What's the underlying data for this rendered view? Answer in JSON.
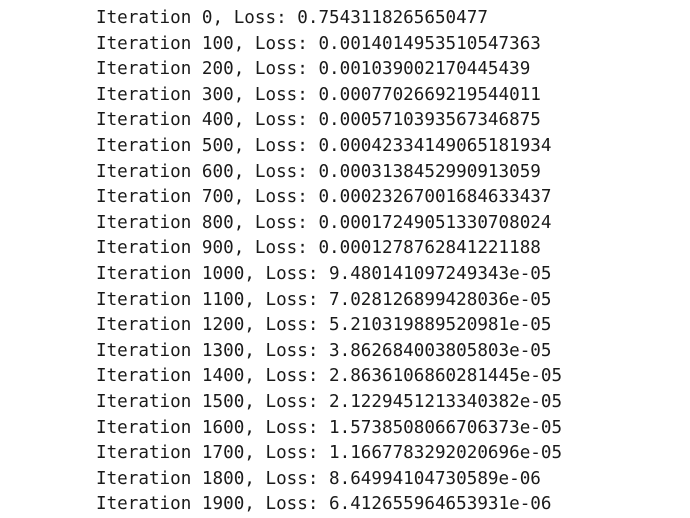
{
  "log": {
    "lines": [
      "Iteration 0, Loss: 0.7543118265650477",
      "Iteration 100, Loss: 0.0014014953510547363",
      "Iteration 200, Loss: 0.001039002170445439",
      "Iteration 300, Loss: 0.0007702669219544011",
      "Iteration 400, Loss: 0.0005710393567346875",
      "Iteration 500, Loss: 0.00042334149065181934",
      "Iteration 600, Loss: 0.0003138452990913059",
      "Iteration 700, Loss: 0.00023267001684633437",
      "Iteration 800, Loss: 0.00017249051330708024",
      "Iteration 900, Loss: 0.0001278762841221188",
      "Iteration 1000, Loss: 9.480141097249343e-05",
      "Iteration 1100, Loss: 7.028126899428036e-05",
      "Iteration 1200, Loss: 5.210319889520981e-05",
      "Iteration 1300, Loss: 3.862684003805803e-05",
      "Iteration 1400, Loss: 2.8636106860281445e-05",
      "Iteration 1500, Loss: 2.1229451213340382e-05",
      "Iteration 1600, Loss: 1.5738508066706373e-05",
      "Iteration 1700, Loss: 1.1667783292020696e-05",
      "Iteration 1800, Loss: 8.64994104730589e-06",
      "Iteration 1900, Loss: 6.412655964653931e-06"
    ]
  }
}
